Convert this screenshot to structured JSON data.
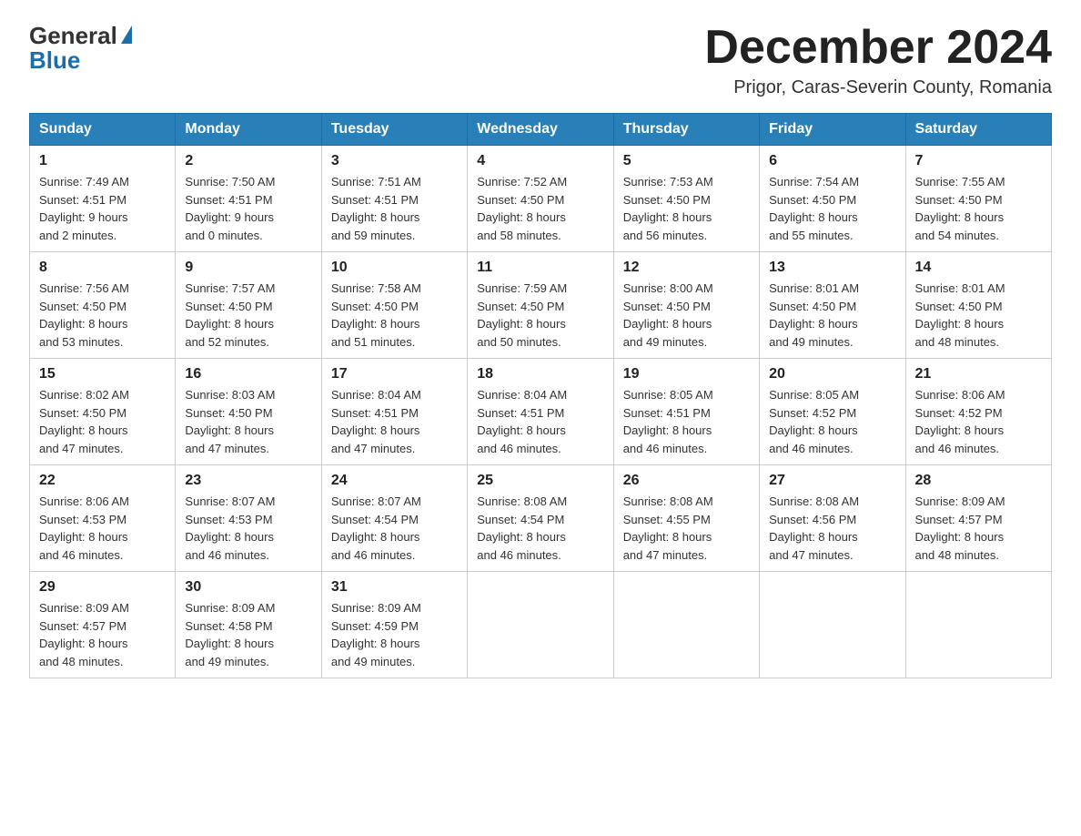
{
  "logo": {
    "general": "General",
    "blue": "Blue"
  },
  "header": {
    "title": "December 2024",
    "location": "Prigor, Caras-Severin County, Romania"
  },
  "weekdays": [
    "Sunday",
    "Monday",
    "Tuesday",
    "Wednesday",
    "Thursday",
    "Friday",
    "Saturday"
  ],
  "weeks": [
    [
      {
        "day": 1,
        "sunrise": "7:49 AM",
        "sunset": "4:51 PM",
        "daylight": "9 hours and 2 minutes."
      },
      {
        "day": 2,
        "sunrise": "7:50 AM",
        "sunset": "4:51 PM",
        "daylight": "9 hours and 0 minutes."
      },
      {
        "day": 3,
        "sunrise": "7:51 AM",
        "sunset": "4:51 PM",
        "daylight": "8 hours and 59 minutes."
      },
      {
        "day": 4,
        "sunrise": "7:52 AM",
        "sunset": "4:50 PM",
        "daylight": "8 hours and 58 minutes."
      },
      {
        "day": 5,
        "sunrise": "7:53 AM",
        "sunset": "4:50 PM",
        "daylight": "8 hours and 56 minutes."
      },
      {
        "day": 6,
        "sunrise": "7:54 AM",
        "sunset": "4:50 PM",
        "daylight": "8 hours and 55 minutes."
      },
      {
        "day": 7,
        "sunrise": "7:55 AM",
        "sunset": "4:50 PM",
        "daylight": "8 hours and 54 minutes."
      }
    ],
    [
      {
        "day": 8,
        "sunrise": "7:56 AM",
        "sunset": "4:50 PM",
        "daylight": "8 hours and 53 minutes."
      },
      {
        "day": 9,
        "sunrise": "7:57 AM",
        "sunset": "4:50 PM",
        "daylight": "8 hours and 52 minutes."
      },
      {
        "day": 10,
        "sunrise": "7:58 AM",
        "sunset": "4:50 PM",
        "daylight": "8 hours and 51 minutes."
      },
      {
        "day": 11,
        "sunrise": "7:59 AM",
        "sunset": "4:50 PM",
        "daylight": "8 hours and 50 minutes."
      },
      {
        "day": 12,
        "sunrise": "8:00 AM",
        "sunset": "4:50 PM",
        "daylight": "8 hours and 49 minutes."
      },
      {
        "day": 13,
        "sunrise": "8:01 AM",
        "sunset": "4:50 PM",
        "daylight": "8 hours and 49 minutes."
      },
      {
        "day": 14,
        "sunrise": "8:01 AM",
        "sunset": "4:50 PM",
        "daylight": "8 hours and 48 minutes."
      }
    ],
    [
      {
        "day": 15,
        "sunrise": "8:02 AM",
        "sunset": "4:50 PM",
        "daylight": "8 hours and 47 minutes."
      },
      {
        "day": 16,
        "sunrise": "8:03 AM",
        "sunset": "4:50 PM",
        "daylight": "8 hours and 47 minutes."
      },
      {
        "day": 17,
        "sunrise": "8:04 AM",
        "sunset": "4:51 PM",
        "daylight": "8 hours and 47 minutes."
      },
      {
        "day": 18,
        "sunrise": "8:04 AM",
        "sunset": "4:51 PM",
        "daylight": "8 hours and 46 minutes."
      },
      {
        "day": 19,
        "sunrise": "8:05 AM",
        "sunset": "4:51 PM",
        "daylight": "8 hours and 46 minutes."
      },
      {
        "day": 20,
        "sunrise": "8:05 AM",
        "sunset": "4:52 PM",
        "daylight": "8 hours and 46 minutes."
      },
      {
        "day": 21,
        "sunrise": "8:06 AM",
        "sunset": "4:52 PM",
        "daylight": "8 hours and 46 minutes."
      }
    ],
    [
      {
        "day": 22,
        "sunrise": "8:06 AM",
        "sunset": "4:53 PM",
        "daylight": "8 hours and 46 minutes."
      },
      {
        "day": 23,
        "sunrise": "8:07 AM",
        "sunset": "4:53 PM",
        "daylight": "8 hours and 46 minutes."
      },
      {
        "day": 24,
        "sunrise": "8:07 AM",
        "sunset": "4:54 PM",
        "daylight": "8 hours and 46 minutes."
      },
      {
        "day": 25,
        "sunrise": "8:08 AM",
        "sunset": "4:54 PM",
        "daylight": "8 hours and 46 minutes."
      },
      {
        "day": 26,
        "sunrise": "8:08 AM",
        "sunset": "4:55 PM",
        "daylight": "8 hours and 47 minutes."
      },
      {
        "day": 27,
        "sunrise": "8:08 AM",
        "sunset": "4:56 PM",
        "daylight": "8 hours and 47 minutes."
      },
      {
        "day": 28,
        "sunrise": "8:09 AM",
        "sunset": "4:57 PM",
        "daylight": "8 hours and 48 minutes."
      }
    ],
    [
      {
        "day": 29,
        "sunrise": "8:09 AM",
        "sunset": "4:57 PM",
        "daylight": "8 hours and 48 minutes."
      },
      {
        "day": 30,
        "sunrise": "8:09 AM",
        "sunset": "4:58 PM",
        "daylight": "8 hours and 49 minutes."
      },
      {
        "day": 31,
        "sunrise": "8:09 AM",
        "sunset": "4:59 PM",
        "daylight": "8 hours and 49 minutes."
      },
      null,
      null,
      null,
      null
    ]
  ],
  "labels": {
    "sunrise": "Sunrise:",
    "sunset": "Sunset:",
    "daylight": "Daylight:"
  }
}
